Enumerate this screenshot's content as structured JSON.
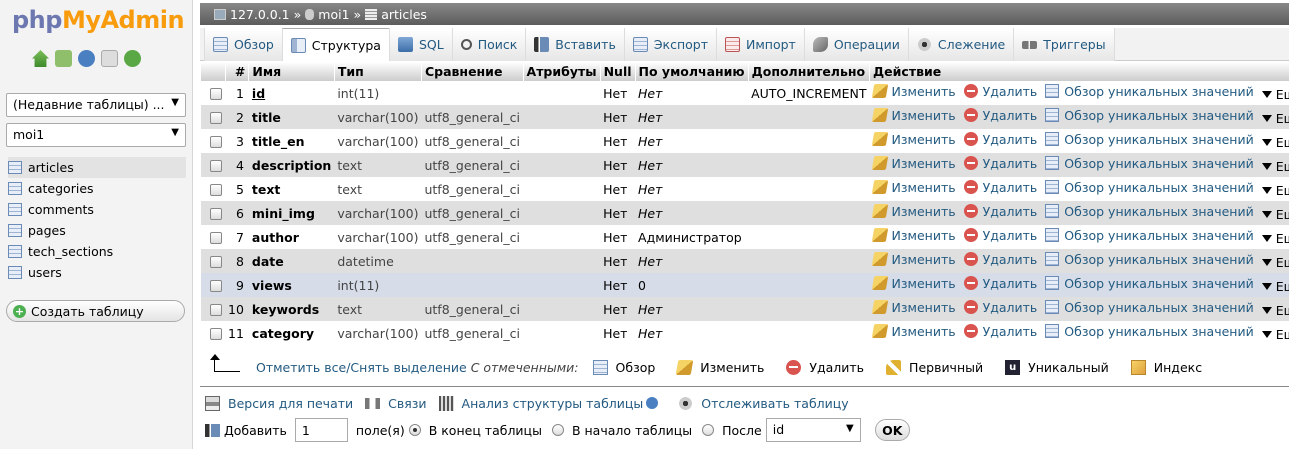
{
  "app": {
    "logo_left": "php",
    "logo_right": "MyAdmin"
  },
  "sidebar": {
    "recent_tables": "(Недавние таблицы) ...",
    "database": "moi1",
    "tables": [
      "articles",
      "categories",
      "comments",
      "pages",
      "tech_sections",
      "users"
    ],
    "create_table": "Создать таблицу"
  },
  "breadcrumb": {
    "server": "127.0.0.1",
    "sep": "»",
    "database": "moi1",
    "table": "articles"
  },
  "tabs": [
    {
      "label": "Обзор",
      "icon": "browse-icon",
      "active": false
    },
    {
      "label": "Структура",
      "icon": "structure-icon",
      "active": true
    },
    {
      "label": "SQL",
      "icon": "sql-icon",
      "active": false
    },
    {
      "label": "Поиск",
      "icon": "search-icon",
      "active": false
    },
    {
      "label": "Вставить",
      "icon": "insert-icon",
      "active": false
    },
    {
      "label": "Экспорт",
      "icon": "export-icon",
      "active": false
    },
    {
      "label": "Импорт",
      "icon": "import-icon",
      "active": false
    },
    {
      "label": "Операции",
      "icon": "operations-icon",
      "active": false
    },
    {
      "label": "Слежение",
      "icon": "tracking-icon",
      "active": false
    },
    {
      "label": "Триггеры",
      "icon": "triggers-icon",
      "active": false
    }
  ],
  "table": {
    "headers": [
      "#",
      "Имя",
      "Тип",
      "Сравнение",
      "Атрибуты",
      "Null",
      "По умолчанию",
      "Дополнительно",
      "Действие"
    ],
    "actions": {
      "change": "Изменить",
      "delete": "Удалить",
      "browse_distinct": "Обзор уникальных значений",
      "more": "Ещё"
    },
    "rows": [
      {
        "num": "1",
        "name": "id",
        "type": "int(11)",
        "collation": "",
        "attributes": "",
        "null": "Нет",
        "default": "Нет",
        "extra": "AUTO_INCREMENT"
      },
      {
        "num": "2",
        "name": "title",
        "type": "varchar(100)",
        "collation": "utf8_general_ci",
        "attributes": "",
        "null": "Нет",
        "default": "Нет",
        "extra": ""
      },
      {
        "num": "3",
        "name": "title_en",
        "type": "varchar(100)",
        "collation": "utf8_general_ci",
        "attributes": "",
        "null": "Нет",
        "default": "Нет",
        "extra": ""
      },
      {
        "num": "4",
        "name": "description",
        "type": "text",
        "collation": "utf8_general_ci",
        "attributes": "",
        "null": "Нет",
        "default": "Нет",
        "extra": ""
      },
      {
        "num": "5",
        "name": "text",
        "type": "text",
        "collation": "utf8_general_ci",
        "attributes": "",
        "null": "Нет",
        "default": "Нет",
        "extra": ""
      },
      {
        "num": "6",
        "name": "mini_img",
        "type": "varchar(100)",
        "collation": "utf8_general_ci",
        "attributes": "",
        "null": "Нет",
        "default": "Нет",
        "extra": ""
      },
      {
        "num": "7",
        "name": "author",
        "type": "varchar(100)",
        "collation": "utf8_general_ci",
        "attributes": "",
        "null": "Нет",
        "default": "Администратор",
        "extra": ""
      },
      {
        "num": "8",
        "name": "date",
        "type": "datetime",
        "collation": "",
        "attributes": "",
        "null": "Нет",
        "default": "Нет",
        "extra": ""
      },
      {
        "num": "9",
        "name": "views",
        "type": "int(11)",
        "collation": "",
        "attributes": "",
        "null": "Нет",
        "default": "0",
        "extra": ""
      },
      {
        "num": "10",
        "name": "keywords",
        "type": "text",
        "collation": "utf8_general_ci",
        "attributes": "",
        "null": "Нет",
        "default": "Нет",
        "extra": ""
      },
      {
        "num": "11",
        "name": "category",
        "type": "varchar(100)",
        "collation": "utf8_general_ci",
        "attributes": "",
        "null": "Нет",
        "default": "Нет",
        "extra": ""
      }
    ]
  },
  "selection_bar": {
    "check_all": "Отметить все",
    "slash": " / ",
    "uncheck_all": "Снять выделение",
    "with_selected": "С отмеченными:",
    "browse": "Обзор",
    "change": "Изменить",
    "delete": "Удалить",
    "primary": "Первичный",
    "unique": "Уникальный",
    "index": "Индекс"
  },
  "links_bar": {
    "print_view": "Версия для печати",
    "relations": "Связи",
    "analyze": "Анализ структуры таблицы",
    "track": "Отслеживать таблицу"
  },
  "add_bar": {
    "add_label": "Добавить",
    "count_value": "1",
    "fields_label": "поле(я)",
    "at_end": "В конец таблицы",
    "at_beginning": "В начало таблицы",
    "after": "После",
    "after_column": "id",
    "ok": "OK"
  }
}
